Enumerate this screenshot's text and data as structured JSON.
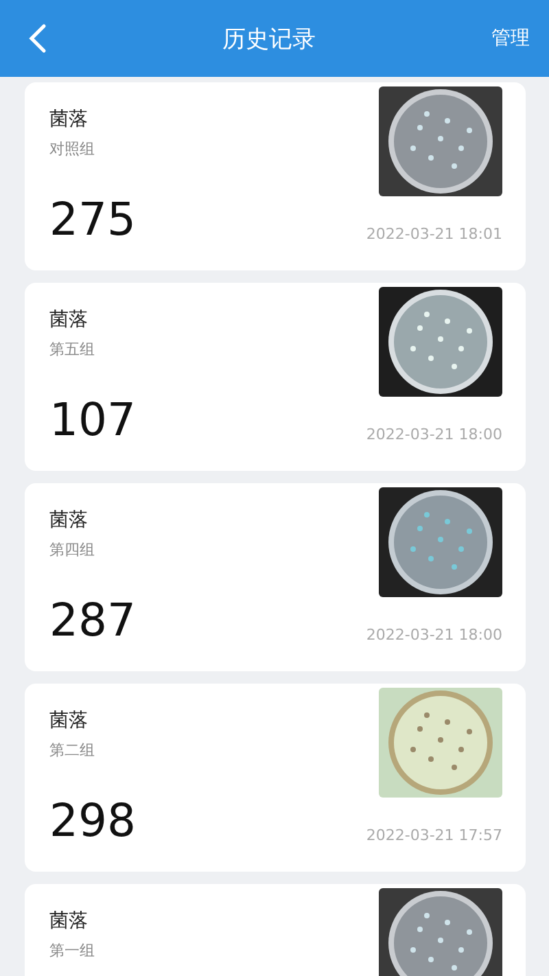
{
  "header": {
    "title": "历史记录",
    "action": "管理"
  },
  "records": [
    {
      "title": "菌落",
      "group": "对照组",
      "count": "275",
      "date": "2022-03-21 18:01"
    },
    {
      "title": "菌落",
      "group": "第五组",
      "count": "107",
      "date": "2022-03-21 18:00"
    },
    {
      "title": "菌落",
      "group": "第四组",
      "count": "287",
      "date": "2022-03-21 18:00"
    },
    {
      "title": "菌落",
      "group": "第二组",
      "count": "298",
      "date": "2022-03-21 17:57"
    },
    {
      "title": "菌落",
      "group": "第一组"
    }
  ]
}
